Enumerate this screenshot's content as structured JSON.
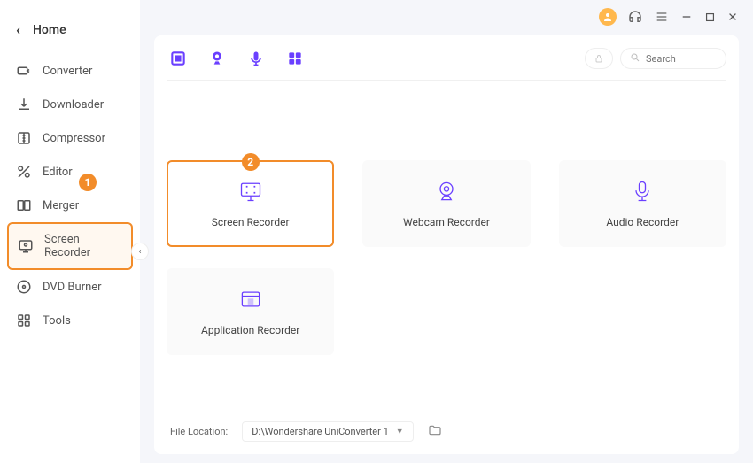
{
  "sidebar": {
    "title": "Home",
    "items": [
      {
        "label": "Converter"
      },
      {
        "label": "Downloader"
      },
      {
        "label": "Compressor"
      },
      {
        "label": "Editor"
      },
      {
        "label": "Merger"
      },
      {
        "label": "Screen Recorder"
      },
      {
        "label": "DVD Burner"
      },
      {
        "label": "Tools"
      }
    ]
  },
  "toolbar": {
    "search_placeholder": "Search"
  },
  "cards": [
    {
      "label": "Screen Recorder"
    },
    {
      "label": "Webcam Recorder"
    },
    {
      "label": "Audio Recorder"
    },
    {
      "label": "Application Recorder"
    }
  ],
  "footer": {
    "label": "File Location:",
    "path": "D:\\Wondershare UniConverter 1"
  },
  "annotations": {
    "step1": "1",
    "step2": "2"
  }
}
